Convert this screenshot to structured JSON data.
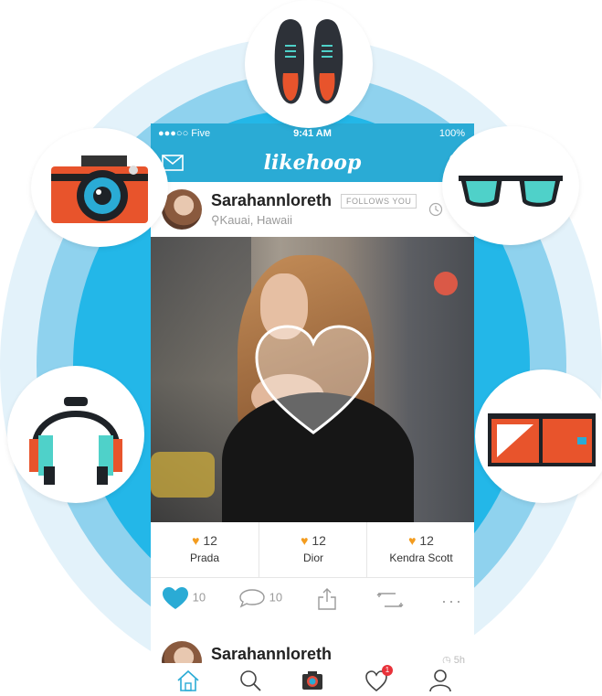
{
  "status_bar": {
    "carrier": "●●●○○ Five",
    "time": "9:41 AM",
    "battery": "100%"
  },
  "app": {
    "brand": "likehoop"
  },
  "post": {
    "username": "Sarahannloreth",
    "follow_badge": "FOLLOWS YOU",
    "location": "Kauai, Hawaii"
  },
  "tags": [
    {
      "count": "12",
      "name": "Prada"
    },
    {
      "count": "12",
      "name": "Dior"
    },
    {
      "count": "12",
      "name": "Kendra Scott"
    }
  ],
  "actions": {
    "likes": "10",
    "comments": "10"
  },
  "next_post": {
    "username": "Sarahannloreth",
    "time": "5h"
  },
  "tab_bar": {
    "notification_count": "1"
  },
  "bubbles": [
    "shoes-icon",
    "camera-icon",
    "sunglasses-icon",
    "headphones-icon",
    "wallet-icon"
  ],
  "colors": {
    "brand_blue": "#2aabd5",
    "heart_orange": "#f39c1f",
    "ring_blue": "#23b7e8"
  }
}
